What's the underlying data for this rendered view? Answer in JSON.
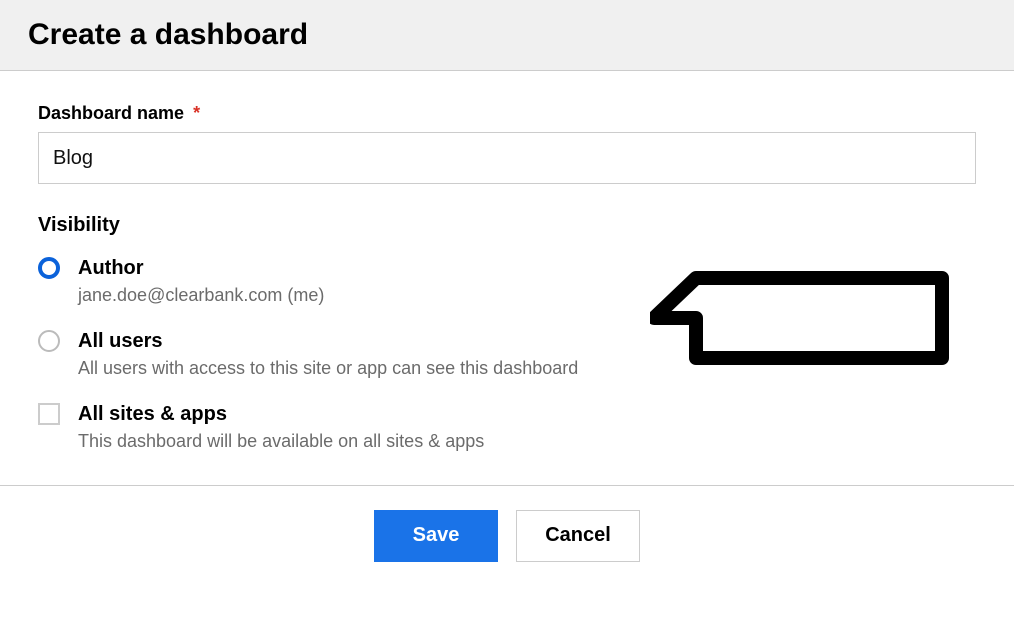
{
  "header": {
    "title": "Create a dashboard"
  },
  "form": {
    "name_label": "Dashboard name",
    "required_mark": "*",
    "name_value": "Blog",
    "visibility_label": "Visibility",
    "visibility_options": [
      {
        "title": "Author",
        "desc": "jane.doe@clearbank.com (me)",
        "selected": true
      },
      {
        "title": "All users",
        "desc": "All users with access to this site or app can see this dashboard",
        "selected": false
      }
    ],
    "all_sites": {
      "title": "All sites & apps",
      "desc": "This dashboard will be available on all sites & apps",
      "checked": false
    }
  },
  "footer": {
    "save_label": "Save",
    "cancel_label": "Cancel"
  }
}
